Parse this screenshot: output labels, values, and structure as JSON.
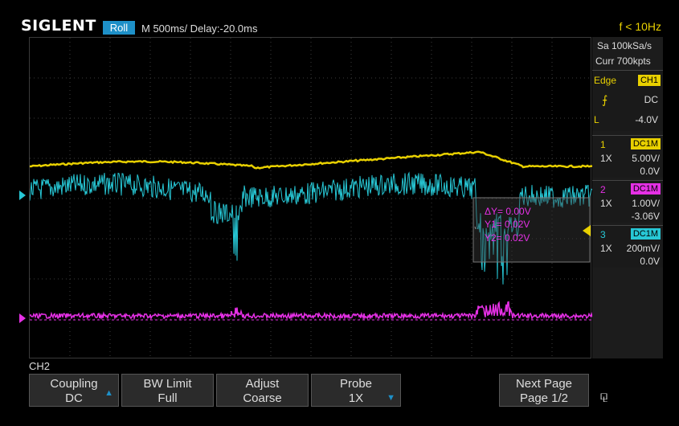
{
  "header": {
    "logo": "SIGLENT",
    "mode": "Roll",
    "timebase": "M 500ms/  Delay:-20.0ms",
    "frequency": "f < 10Hz"
  },
  "acquisition": {
    "sample_rate": "Sa 100kSa/s",
    "memory": "Curr 700kpts"
  },
  "trigger": {
    "type": "Edge",
    "source": "CH1",
    "coupling": "DC",
    "slope_icon": "rising-edge-icon",
    "level_label": "L",
    "level": "-4.0V"
  },
  "channels": [
    {
      "num": "1",
      "coupling": "DC1M",
      "probe": "1X",
      "scale": "5.00V/",
      "offset": "0.0V",
      "color": "#e8d000"
    },
    {
      "num": "2",
      "coupling": "DC1M",
      "probe": "1X",
      "scale": "1.00V/",
      "offset": "-3.06V",
      "color": "#e530e5"
    },
    {
      "num": "3",
      "coupling": "DC1M",
      "probe": "1X",
      "scale": "200mV/",
      "offset": "0.0V",
      "color": "#27c8d6"
    }
  ],
  "measure": {
    "dy": "ΔY= 0.00V",
    "y1": "Y1= 0.02V",
    "y2": "Y2= 0.02V"
  },
  "menu": {
    "channel": "CH2",
    "coupling_label": "Coupling",
    "coupling_value": "DC",
    "bw_label": "BW Limit",
    "bw_value": "Full",
    "adjust_label": "Adjust",
    "adjust_value": "Coarse",
    "probe_label": "Probe",
    "probe_value": "1X",
    "next_label": "Next Page",
    "next_value": "Page 1/2"
  },
  "colors": {
    "ch1": "#e8d000",
    "ch2": "#e530e5",
    "ch3": "#27c8d6",
    "accent": "#1e90c8"
  }
}
